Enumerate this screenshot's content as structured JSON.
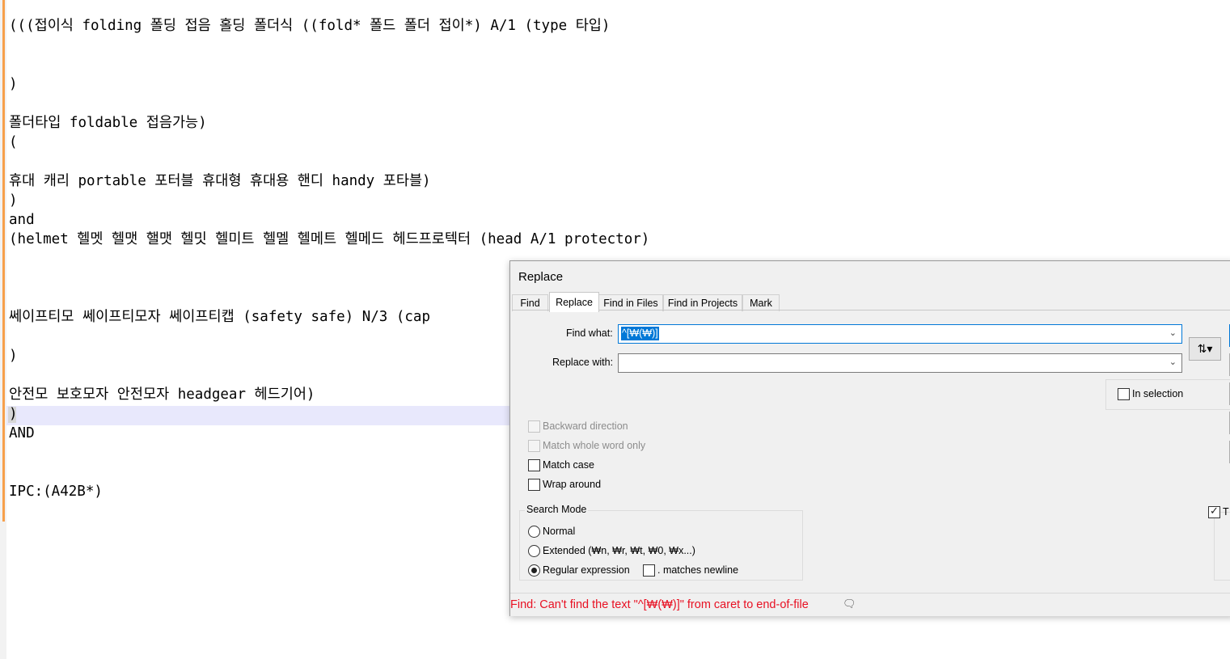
{
  "editor": {
    "lines": [
      "(((접이식 folding 폴딩 접음 홀딩 폴더식 ((fold* 폴드 폴더 접이*) A/1 (type 타입)",
      ")",
      "폴더타입 foldable 접음가능)",
      "(",
      "휴대 캐리 portable 포터블 휴대형 휴대용 핸디 handy 포타블)",
      ")",
      "and",
      "(helmet 헬멧 헬맷 핼맷 헬밋 헬미트 헬멜 헬메트 헬메드 헤드프로텍터 (head A/1 protector)",
      "쎄이프티모 쎄이프티모자 쎄이프티캡 (safety safe) N/3 (cap",
      ")",
      "안전모 보호모자 안전모자 headgear 헤드기어)",
      ")",
      "AND",
      "IPC:(A42B*)"
    ]
  },
  "dialog": {
    "title": "Replace",
    "tabs": [
      "Find",
      "Replace",
      "Find in Files",
      "Find in Projects",
      "Mark"
    ],
    "active_tab": "Replace",
    "find_label": "Find what:",
    "find_value": "^[₩(₩)]",
    "replace_label": "Replace with:",
    "replace_value": "",
    "in_selection_label": "In selection",
    "options": {
      "backward": "Backward direction",
      "whole_word": "Match whole word only",
      "match_case": "Match case",
      "wrap_around": "Wrap around"
    },
    "search_mode": {
      "title": "Search Mode",
      "normal": "Normal",
      "extended": "Extended (₩n, ₩r, ₩t, ₩0, ₩x...)",
      "regex": "Regular expression",
      "dot_newline": ". matches newline",
      "selected": "Regular expression"
    },
    "transparency_partial": "T",
    "status": "Find: Can't find the text \"^[₩(₩)]\" from caret to end-of-file"
  },
  "colors": {
    "status_error": "#e81123",
    "selection": "#0078d7",
    "change_bar": "#f7a04b",
    "current_line": "#e8e8fc"
  }
}
